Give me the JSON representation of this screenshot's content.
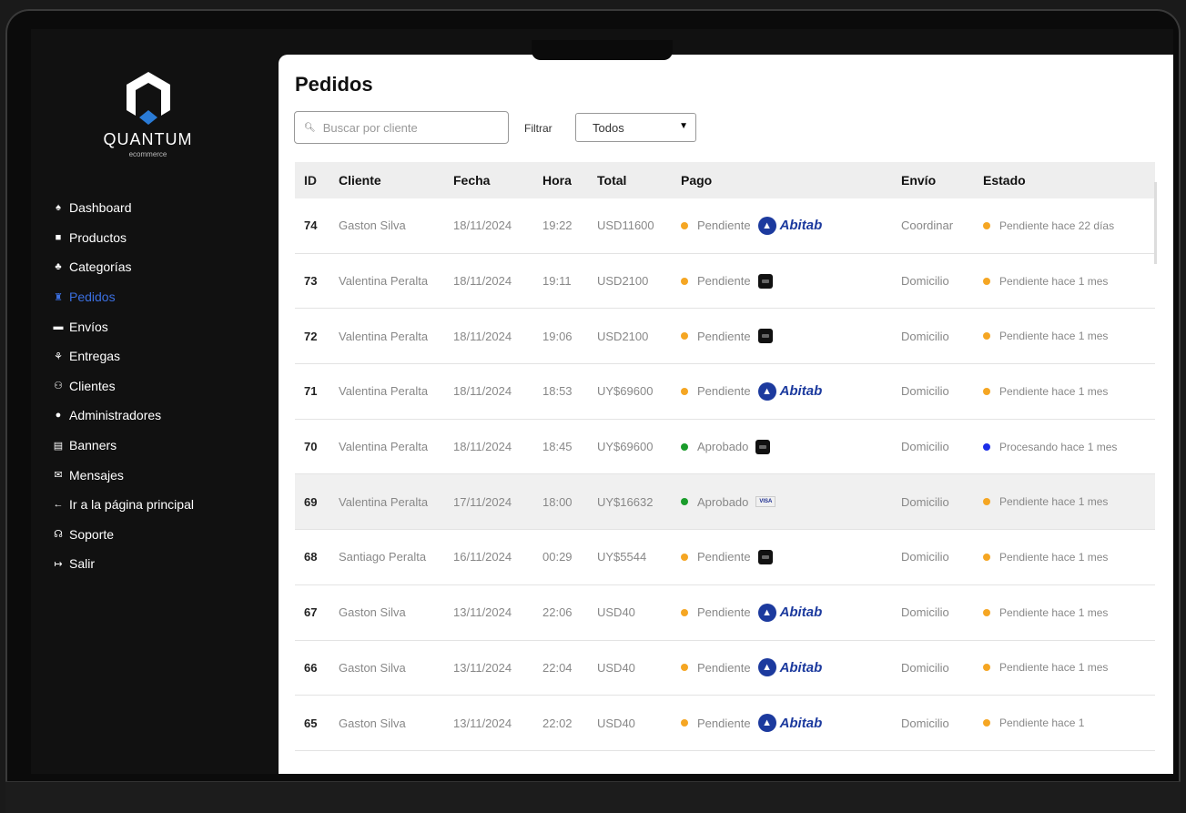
{
  "brand": {
    "name": "QUANTUM",
    "subtitle": "ecommerce"
  },
  "sidebar": {
    "items": [
      {
        "label": "Dashboard",
        "icon": "home-icon",
        "glyph": "♠",
        "active": false
      },
      {
        "label": "Productos",
        "icon": "box-icon",
        "glyph": "■",
        "active": false
      },
      {
        "label": "Categorías",
        "icon": "sitemap-icon",
        "glyph": "♣",
        "active": false
      },
      {
        "label": "Pedidos",
        "icon": "cart-icon",
        "glyph": "♜",
        "active": true
      },
      {
        "label": "Envíos",
        "icon": "truck-icon",
        "glyph": "▬",
        "active": false
      },
      {
        "label": "Entregas",
        "icon": "delivery-icon",
        "glyph": "⚘",
        "active": false
      },
      {
        "label": "Clientes",
        "icon": "users-icon",
        "glyph": "⚇",
        "active": false
      },
      {
        "label": "Administradores",
        "icon": "user-shield-icon",
        "glyph": "●",
        "active": false
      },
      {
        "label": "Banners",
        "icon": "image-icon",
        "glyph": "▤",
        "active": false
      },
      {
        "label": "Mensajes",
        "icon": "envelope-icon",
        "glyph": "✉",
        "active": false
      },
      {
        "label": "Ir a la página principal",
        "icon": "arrow-left-icon",
        "glyph": "←",
        "active": false
      },
      {
        "label": "Soporte",
        "icon": "headset-icon",
        "glyph": "☊",
        "active": false
      },
      {
        "label": "Salir",
        "icon": "logout-icon",
        "glyph": "↦",
        "active": false
      }
    ]
  },
  "main": {
    "title": "Pedidos",
    "search": {
      "placeholder": "Buscar por cliente"
    },
    "filter": {
      "label": "Filtrar",
      "selected": "Todos"
    }
  },
  "table": {
    "headers": [
      "ID",
      "Cliente",
      "Fecha",
      "Hora",
      "Total",
      "Pago",
      "Envío",
      "Estado"
    ],
    "rows": [
      {
        "id": "74",
        "cliente": "Gaston Silva",
        "fecha": "18/11/2024",
        "hora": "19:22",
        "total": "USD11600",
        "pago": "Pendiente",
        "pago_color": "#f5a623",
        "metodo": "abitab",
        "envio": "Coordinar",
        "estado": "Pendiente hace 22 días",
        "estado_color": "#f5a623",
        "highlight": false
      },
      {
        "id": "73",
        "cliente": "Valentina Peralta",
        "fecha": "18/11/2024",
        "hora": "19:11",
        "total": "USD2100",
        "pago": "Pendiente",
        "pago_color": "#f5a623",
        "metodo": "redpagos",
        "envio": "Domicilio",
        "estado": "Pendiente hace 1 mes",
        "estado_color": "#f5a623",
        "highlight": false
      },
      {
        "id": "72",
        "cliente": "Valentina Peralta",
        "fecha": "18/11/2024",
        "hora": "19:06",
        "total": "USD2100",
        "pago": "Pendiente",
        "pago_color": "#f5a623",
        "metodo": "redpagos",
        "envio": "Domicilio",
        "estado": "Pendiente hace 1 mes",
        "estado_color": "#f5a623",
        "highlight": false
      },
      {
        "id": "71",
        "cliente": "Valentina Peralta",
        "fecha": "18/11/2024",
        "hora": "18:53",
        "total": "UY$69600",
        "pago": "Pendiente",
        "pago_color": "#f5a623",
        "metodo": "abitab",
        "envio": "Domicilio",
        "estado": "Pendiente hace 1 mes",
        "estado_color": "#f5a623",
        "highlight": false
      },
      {
        "id": "70",
        "cliente": "Valentina Peralta",
        "fecha": "18/11/2024",
        "hora": "18:45",
        "total": "UY$69600",
        "pago": "Aprobado",
        "pago_color": "#1a9c2b",
        "metodo": "redpagos",
        "envio": "Domicilio",
        "estado": "Procesando hace 1 mes",
        "estado_color": "#1c2ee8",
        "highlight": false
      },
      {
        "id": "69",
        "cliente": "Valentina Peralta",
        "fecha": "17/11/2024",
        "hora": "18:00",
        "total": "UY$16632",
        "pago": "Aprobado",
        "pago_color": "#1a9c2b",
        "metodo": "visa",
        "envio": "Domicilio",
        "estado": "Pendiente hace 1 mes",
        "estado_color": "#f5a623",
        "highlight": true
      },
      {
        "id": "68",
        "cliente": "Santiago Peralta",
        "fecha": "16/11/2024",
        "hora": "00:29",
        "total": "UY$5544",
        "pago": "Pendiente",
        "pago_color": "#f5a623",
        "metodo": "redpagos",
        "envio": "Domicilio",
        "estado": "Pendiente hace 1 mes",
        "estado_color": "#f5a623",
        "highlight": false
      },
      {
        "id": "67",
        "cliente": "Gaston Silva",
        "fecha": "13/11/2024",
        "hora": "22:06",
        "total": "USD40",
        "pago": "Pendiente",
        "pago_color": "#f5a623",
        "metodo": "abitab",
        "envio": "Domicilio",
        "estado": "Pendiente hace 1 mes",
        "estado_color": "#f5a623",
        "highlight": false
      },
      {
        "id": "66",
        "cliente": "Gaston Silva",
        "fecha": "13/11/2024",
        "hora": "22:04",
        "total": "USD40",
        "pago": "Pendiente",
        "pago_color": "#f5a623",
        "metodo": "abitab",
        "envio": "Domicilio",
        "estado": "Pendiente hace 1 mes",
        "estado_color": "#f5a623",
        "highlight": false
      },
      {
        "id": "65",
        "cliente": "Gaston Silva",
        "fecha": "13/11/2024",
        "hora": "22:02",
        "total": "USD40",
        "pago": "Pendiente",
        "pago_color": "#f5a623",
        "metodo": "abitab",
        "envio": "Domicilio",
        "estado": "Pendiente hace 1",
        "estado_color": "#f5a623",
        "highlight": false
      }
    ],
    "payment_logos": {
      "abitab": "Abitab",
      "visa": "VISA"
    }
  },
  "colors": {
    "active_nav": "#3b6fe0",
    "accent": "#2a7bd6"
  }
}
